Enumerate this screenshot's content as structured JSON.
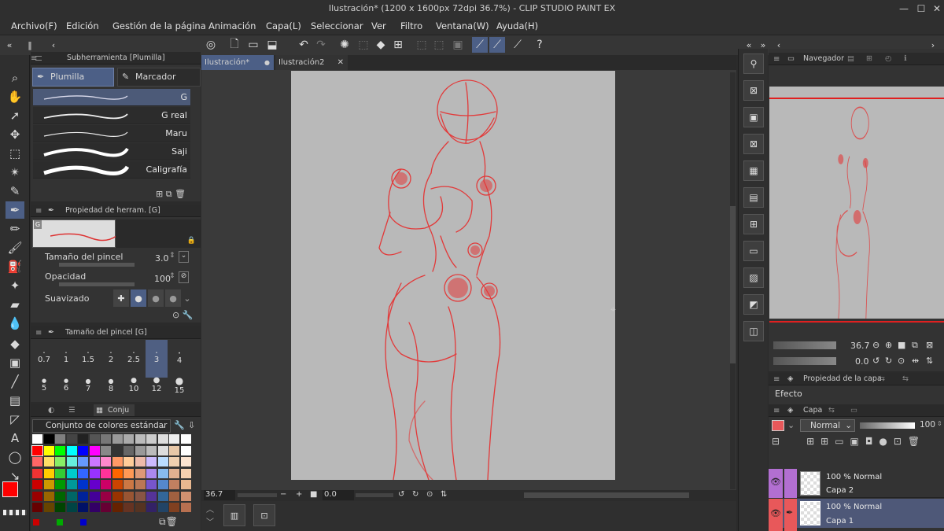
{
  "window": {
    "title": "Ilustración* (1200 x 1600px 72dpi 36.7%) - CLIP STUDIO PAINT EX"
  },
  "menu": [
    "Archivo(F)",
    "Edición",
    "Gestión de la página",
    "Animación",
    "Capa(L)",
    "Seleccionar",
    "Ver",
    "Filtro",
    "Ventana(W)",
    "Ayuda(H)"
  ],
  "subtool": {
    "header": "Subherramienta [Plumilla]",
    "tabs": [
      "Plumilla",
      "Marcador"
    ],
    "brushes": [
      "G",
      "G real",
      "Maru",
      "Saji",
      "Caligrafía"
    ]
  },
  "toolprop": {
    "header": "Propiedad de herram. [G]",
    "tag": "G",
    "brush_size_label": "Tamaño del pincel",
    "brush_size_value": "3.0",
    "opacity_label": "Opacidad",
    "opacity_value": "100",
    "smoothing_label": "Suavizado"
  },
  "brushsize": {
    "header": "Tamaño del pincel [G]",
    "row1": [
      "0.7",
      "1",
      "1.5",
      "2",
      "2.5",
      "3",
      "4"
    ],
    "row2": [
      "5",
      "6",
      "7",
      "8",
      "10",
      "12",
      "15"
    ]
  },
  "colors": {
    "tab_label": "Conju",
    "set_name": "Conjunto de colores estándar",
    "main_color": "#ff0000",
    "sub_color": "#ffffff"
  },
  "documents": {
    "tabs": [
      "Ilustración*",
      "Ilustración2"
    ]
  },
  "status": {
    "zoom": "36.7",
    "angle": "0.0"
  },
  "navigator": {
    "header": "Navegador",
    "zoom": "36.7",
    "angle": "0.0"
  },
  "layerprop": {
    "header": "Propiedad de la capa",
    "effect_label": "Efecto"
  },
  "layers": {
    "header": "Capa",
    "blend_mode": "Normal",
    "opacity": "100",
    "items": [
      {
        "mode_line": "100 % Normal",
        "name": "Capa 2",
        "color": "#b26fd1"
      },
      {
        "mode_line": "100 % Normal",
        "name": "Capa 1",
        "color": "#e8585a"
      }
    ]
  }
}
